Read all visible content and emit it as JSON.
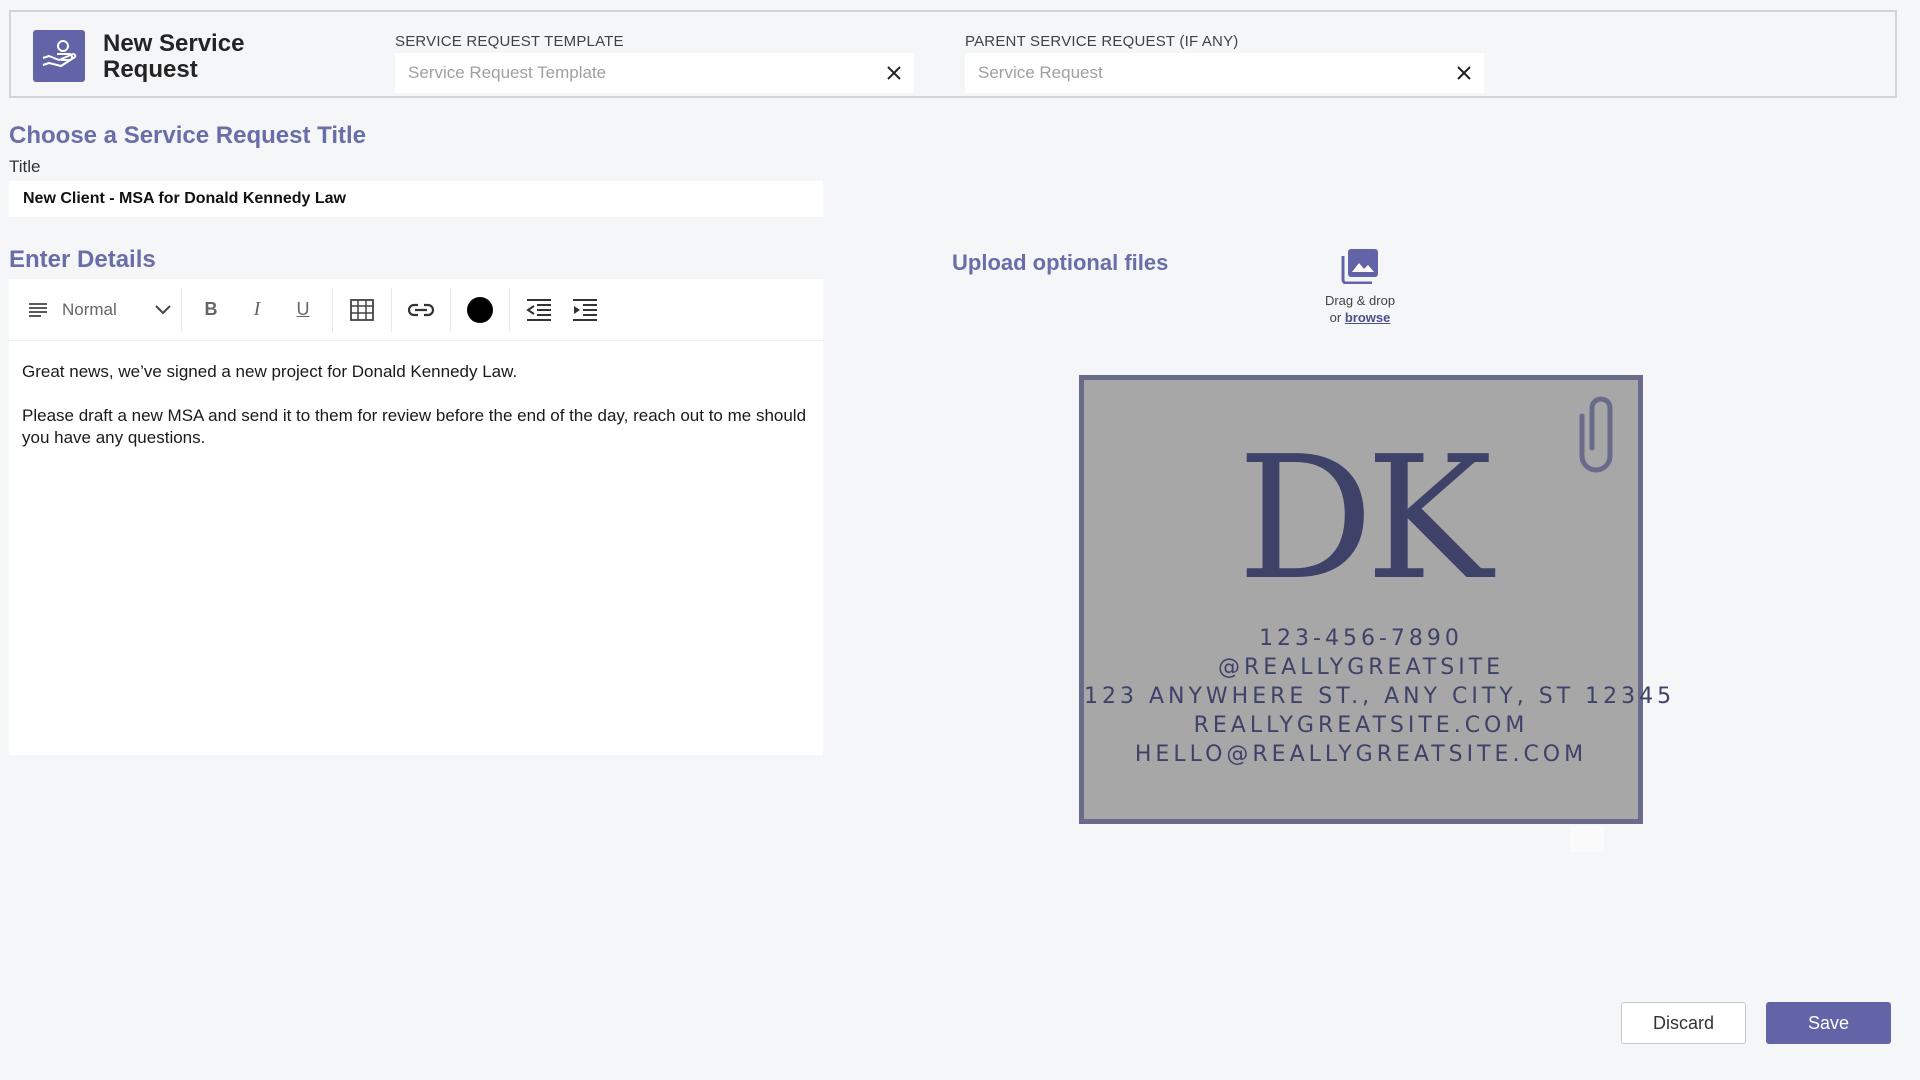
{
  "app": {
    "title": "New Service Request",
    "icon": "hand-service-icon",
    "accent_color": "#6264a7"
  },
  "template_field": {
    "label": "SERVICE REQUEST TEMPLATE",
    "placeholder": "Service Request Template",
    "value": ""
  },
  "parent_field": {
    "label": "PARENT SERVICE REQUEST (IF ANY)",
    "placeholder": "Service Request",
    "value": ""
  },
  "title_section": {
    "heading": "Choose a Service Request Title",
    "label": "Title",
    "value": "New Client - MSA for Donald Kennedy Law"
  },
  "details": {
    "heading": "Enter Details",
    "toolbar": {
      "style_value": "Normal",
      "bold": "B",
      "italic": "I",
      "underline": "U"
    },
    "body": {
      "p1": "Great news, we’ve signed a new project for Donald Kennedy Law.",
      "p2": "Please draft a new MSA and send it to them for review before the end of the day, reach out to me should you have any questions."
    }
  },
  "upload": {
    "heading": "Upload optional files",
    "drag_text": "Drag & drop",
    "or_text": "or",
    "browse_text": "browse",
    "icon": "image-upload-icon"
  },
  "attachment": {
    "monogram": "DK",
    "lines": [
      "123-456-7890",
      "@REALLYGREATSITE",
      "123 ANYWHERE ST., ANY CITY, ST 12345",
      "REALLYGREATSITE.COM",
      "HELLO@REALLYGREATSITE.COM"
    ]
  },
  "actions": {
    "discard": "Discard",
    "save": "Save"
  }
}
